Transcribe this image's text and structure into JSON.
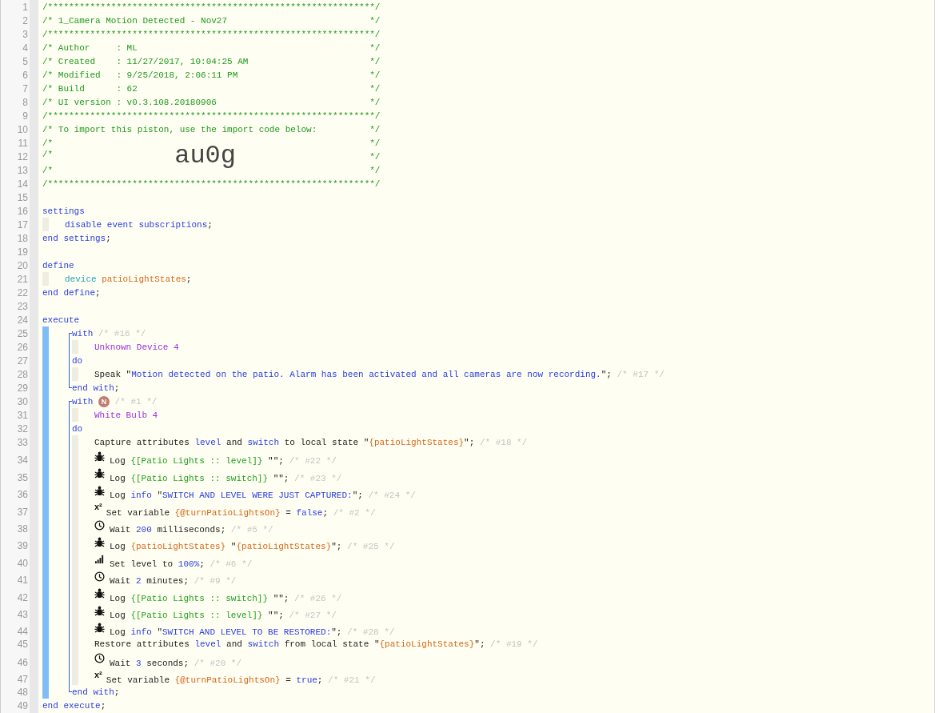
{
  "editor": {
    "lines": [
      {
        "n": "1",
        "kind": "rule",
        "text": "/**************************************************************/"
      },
      {
        "n": "2",
        "kind": "banner",
        "text": "/* 1_Camera Motion Detected - Nov27",
        "end": "*/"
      },
      {
        "n": "3",
        "kind": "rule",
        "text": "/**************************************************************/"
      },
      {
        "n": "4",
        "kind": "banner",
        "text": "/* Author     : ML",
        "end": "*/"
      },
      {
        "n": "5",
        "kind": "banner",
        "text": "/* Created    : 11/27/2017, 10:04:25 AM",
        "end": "*/"
      },
      {
        "n": "6",
        "kind": "banner",
        "text": "/* Modified   : 9/25/2018, 2:06:11 PM",
        "end": "*/"
      },
      {
        "n": "7",
        "kind": "banner",
        "text": "/* Build      : 62",
        "end": "*/"
      },
      {
        "n": "8",
        "kind": "banner",
        "text": "/* UI version : v0.3.108.20180906",
        "end": "*/"
      },
      {
        "n": "9",
        "kind": "rule",
        "text": "/**************************************************************/"
      },
      {
        "n": "10",
        "kind": "banner",
        "text": "/* To import this piston, use the import code below:",
        "end": "*/"
      },
      {
        "n": "11",
        "kind": "banner",
        "text": "/*",
        "end": "*/"
      },
      {
        "n": "12",
        "kind": "banner",
        "text": "/*",
        "code": "au0g",
        "end": "*/"
      },
      {
        "n": "13",
        "kind": "banner",
        "text": "/*",
        "end": "*/"
      },
      {
        "n": "14",
        "kind": "rule",
        "text": "/**************************************************************/"
      },
      {
        "n": "15"
      },
      {
        "n": "16",
        "tokens": [
          {
            "kind": "kw",
            "text": "settings"
          }
        ],
        "children": [
          {
            "n": "17",
            "tokens": [
              {
                "kind": "kw",
                "text": "disable event subscriptions"
              },
              {
                "kind": "txt",
                "text": ";"
              }
            ]
          }
        ]
      },
      {
        "n": "18",
        "tokens": [
          {
            "kind": "kw",
            "text": "end settings"
          },
          {
            "kind": "txt",
            "text": ";"
          }
        ]
      },
      {
        "n": "19"
      },
      {
        "n": "20",
        "tokens": [
          {
            "kind": "kw",
            "text": "define"
          }
        ],
        "children": [
          {
            "n": "21",
            "tokens": [
              {
                "kind": "type",
                "text": "device "
              },
              {
                "kind": "var",
                "text": "patioLightStates"
              },
              {
                "kind": "txt",
                "text": ";"
              }
            ]
          }
        ]
      },
      {
        "n": "22",
        "tokens": [
          {
            "kind": "kw",
            "text": "end define"
          },
          {
            "kind": "txt",
            "text": ";"
          }
        ]
      },
      {
        "n": "23"
      },
      {
        "n": "24",
        "tokens": [
          {
            "kind": "kw",
            "text": "execute"
          }
        ],
        "children": [
          {
            "kind": "group",
            "lines": [
              {
                "n": "25",
                "tokens": [
                  {
                    "kind": "kw",
                    "text": "with"
                  },
                  {
                    "kind": "note",
                    "text": " /* #16 */"
                  }
                ],
                "children": [
                  {
                    "n": "26",
                    "tokens": [
                      {
                        "kind": "dev",
                        "text": "Unknown Device 4"
                      }
                    ]
                  }
                ]
              },
              {
                "n": "27",
                "tokens": [
                  {
                    "kind": "kw",
                    "text": "do"
                  }
                ],
                "children": [
                  {
                    "n": "28",
                    "tokens": [
                      {
                        "kind": "txt",
                        "text": "Speak \""
                      },
                      {
                        "kind": "str",
                        "text": "Motion detected on the patio. Alarm has been activated and all cameras are now recording."
                      },
                      {
                        "kind": "txt",
                        "text": "\";"
                      },
                      {
                        "kind": "note",
                        "text": " /* #17 */"
                      }
                    ]
                  }
                ]
              },
              {
                "n": "29",
                "tokens": [
                  {
                    "kind": "kw",
                    "text": "end with"
                  },
                  {
                    "kind": "txt",
                    "text": ";"
                  }
                ]
              }
            ]
          },
          {
            "kind": "group",
            "lines": [
              {
                "n": "30",
                "tokens": [
                  {
                    "kind": "kw",
                    "text": "with "
                  },
                  {
                    "kind": "badge",
                    "text": "N"
                  },
                  {
                    "kind": "note",
                    "text": " /* #1 */"
                  }
                ],
                "children": [
                  {
                    "n": "31",
                    "tokens": [
                      {
                        "kind": "dev",
                        "text": "White Bulb 4"
                      }
                    ]
                  }
                ]
              },
              {
                "n": "32",
                "tokens": [
                  {
                    "kind": "kw",
                    "text": "do"
                  }
                ],
                "children": [
                  {
                    "n": "33",
                    "tokens": [
                      {
                        "kind": "txt",
                        "text": "Capture attributes "
                      },
                      {
                        "kind": "kw",
                        "text": "level"
                      },
                      {
                        "kind": "txt",
                        "text": " and "
                      },
                      {
                        "kind": "kw",
                        "text": "switch"
                      },
                      {
                        "kind": "txt",
                        "text": " to local state \""
                      },
                      {
                        "kind": "var",
                        "text": "{patioLightStates}"
                      },
                      {
                        "kind": "txt",
                        "text": "\";"
                      },
                      {
                        "kind": "note",
                        "text": " /* #18 */"
                      }
                    ]
                  },
                  {
                    "n": "34",
                    "tokens": [
                      {
                        "kind": "bug"
                      },
                      {
                        "kind": "txt",
                        "text": "Log "
                      },
                      {
                        "kind": "expr",
                        "text": "{[Patio Lights :: level]}"
                      },
                      {
                        "kind": "txt",
                        "text": " \"\";"
                      },
                      {
                        "kind": "note",
                        "text": " /* #22 */"
                      }
                    ]
                  },
                  {
                    "n": "35",
                    "tokens": [
                      {
                        "kind": "bug"
                      },
                      {
                        "kind": "txt",
                        "text": "Log "
                      },
                      {
                        "kind": "expr",
                        "text": "{[Patio Lights :: switch]}"
                      },
                      {
                        "kind": "txt",
                        "text": " \"\";"
                      },
                      {
                        "kind": "note",
                        "text": " /* #23 */"
                      }
                    ]
                  },
                  {
                    "n": "36",
                    "tokens": [
                      {
                        "kind": "bug"
                      },
                      {
                        "kind": "txt",
                        "text": "Log "
                      },
                      {
                        "kind": "kw",
                        "text": "info"
                      },
                      {
                        "kind": "txt",
                        "text": " \""
                      },
                      {
                        "kind": "str",
                        "text": "SWITCH AND LEVEL WERE JUST CAPTURED:"
                      },
                      {
                        "kind": "txt",
                        "text": "\";"
                      },
                      {
                        "kind": "note",
                        "text": " /* #24 */"
                      }
                    ]
                  },
                  {
                    "n": "37",
                    "tokens": [
                      {
                        "kind": "sup",
                        "text": "x²"
                      },
                      {
                        "kind": "txt",
                        "text": "Set variable "
                      },
                      {
                        "kind": "var",
                        "text": "{@turnPatioLightsOn}"
                      },
                      {
                        "kind": "txt",
                        "text": " = "
                      },
                      {
                        "kind": "kw",
                        "text": "false"
                      },
                      {
                        "kind": "txt",
                        "text": ";"
                      },
                      {
                        "kind": "note",
                        "text": " /* #2 */"
                      }
                    ]
                  },
                  {
                    "n": "38",
                    "tokens": [
                      {
                        "kind": "clock"
                      },
                      {
                        "kind": "txt",
                        "text": "Wait "
                      },
                      {
                        "kind": "kw",
                        "text": "200"
                      },
                      {
                        "kind": "txt",
                        "text": " milliseconds;"
                      },
                      {
                        "kind": "note",
                        "text": " /* #5 */"
                      }
                    ]
                  },
                  {
                    "n": "39",
                    "tokens": [
                      {
                        "kind": "bug"
                      },
                      {
                        "kind": "txt",
                        "text": "Log "
                      },
                      {
                        "kind": "var",
                        "text": "{patioLightStates}"
                      },
                      {
                        "kind": "txt",
                        "text": " \""
                      },
                      {
                        "kind": "var",
                        "text": "{patioLightStates}"
                      },
                      {
                        "kind": "txt",
                        "text": "\";"
                      },
                      {
                        "kind": "note",
                        "text": " /* #25 */"
                      }
                    ]
                  },
                  {
                    "n": "40",
                    "tokens": [
                      {
                        "kind": "signal"
                      },
                      {
                        "kind": "txt",
                        "text": "Set level to "
                      },
                      {
                        "kind": "kw",
                        "text": "100%"
                      },
                      {
                        "kind": "txt",
                        "text": ";"
                      },
                      {
                        "kind": "note",
                        "text": " /* #6 */"
                      }
                    ]
                  },
                  {
                    "n": "41",
                    "tokens": [
                      {
                        "kind": "clock"
                      },
                      {
                        "kind": "txt",
                        "text": "Wait "
                      },
                      {
                        "kind": "kw",
                        "text": "2"
                      },
                      {
                        "kind": "txt",
                        "text": " minutes;"
                      },
                      {
                        "kind": "note",
                        "text": " /* #9 */"
                      }
                    ]
                  },
                  {
                    "n": "42",
                    "tokens": [
                      {
                        "kind": "bug"
                      },
                      {
                        "kind": "txt",
                        "text": "Log "
                      },
                      {
                        "kind": "expr",
                        "text": "{[Patio Lights :: switch]}"
                      },
                      {
                        "kind": "txt",
                        "text": " \"\";"
                      },
                      {
                        "kind": "note",
                        "text": " /* #26 */"
                      }
                    ]
                  },
                  {
                    "n": "43",
                    "tokens": [
                      {
                        "kind": "bug"
                      },
                      {
                        "kind": "txt",
                        "text": "Log "
                      },
                      {
                        "kind": "expr",
                        "text": "{[Patio Lights :: level]}"
                      },
                      {
                        "kind": "txt",
                        "text": " \"\";"
                      },
                      {
                        "kind": "note",
                        "text": " /* #27 */"
                      }
                    ]
                  },
                  {
                    "n": "44",
                    "tokens": [
                      {
                        "kind": "bug"
                      },
                      {
                        "kind": "txt",
                        "text": "Log "
                      },
                      {
                        "kind": "kw",
                        "text": "info"
                      },
                      {
                        "kind": "txt",
                        "text": " \""
                      },
                      {
                        "kind": "str",
                        "text": "SWITCH AND LEVEL TO BE RESTORED:"
                      },
                      {
                        "kind": "txt",
                        "text": "\";"
                      },
                      {
                        "kind": "note",
                        "text": " /* #28 */"
                      }
                    ]
                  },
                  {
                    "n": "45",
                    "tokens": [
                      {
                        "kind": "txt",
                        "text": "Restore attributes "
                      },
                      {
                        "kind": "kw",
                        "text": "level"
                      },
                      {
                        "kind": "txt",
                        "text": " and "
                      },
                      {
                        "kind": "kw",
                        "text": "switch"
                      },
                      {
                        "kind": "txt",
                        "text": " from local state \""
                      },
                      {
                        "kind": "var",
                        "text": "{patioLightStates}"
                      },
                      {
                        "kind": "txt",
                        "text": "\";"
                      },
                      {
                        "kind": "note",
                        "text": " /* #19 */"
                      }
                    ]
                  },
                  {
                    "n": "46",
                    "tokens": [
                      {
                        "kind": "clock"
                      },
                      {
                        "kind": "txt",
                        "text": "Wait "
                      },
                      {
                        "kind": "kw",
                        "text": "3"
                      },
                      {
                        "kind": "txt",
                        "text": " seconds;"
                      },
                      {
                        "kind": "note",
                        "text": " /* #20 */"
                      }
                    ]
                  },
                  {
                    "n": "47",
                    "tokens": [
                      {
                        "kind": "sup",
                        "text": "x²"
                      },
                      {
                        "kind": "txt",
                        "text": "Set variable "
                      },
                      {
                        "kind": "var",
                        "text": "{@turnPatioLightsOn}"
                      },
                      {
                        "kind": "txt",
                        "text": " = "
                      },
                      {
                        "kind": "kw",
                        "text": "true"
                      },
                      {
                        "kind": "txt",
                        "text": ";"
                      },
                      {
                        "kind": "note",
                        "text": " /* #21 */"
                      }
                    ]
                  }
                ]
              },
              {
                "n": "48",
                "tokens": [
                  {
                    "kind": "kw",
                    "text": "end with"
                  },
                  {
                    "kind": "txt",
                    "text": ";"
                  }
                ]
              }
            ]
          }
        ]
      },
      {
        "n": "49",
        "tokens": [
          {
            "kind": "kw",
            "text": "end execute"
          },
          {
            "kind": "txt",
            "text": ";"
          }
        ]
      }
    ]
  }
}
